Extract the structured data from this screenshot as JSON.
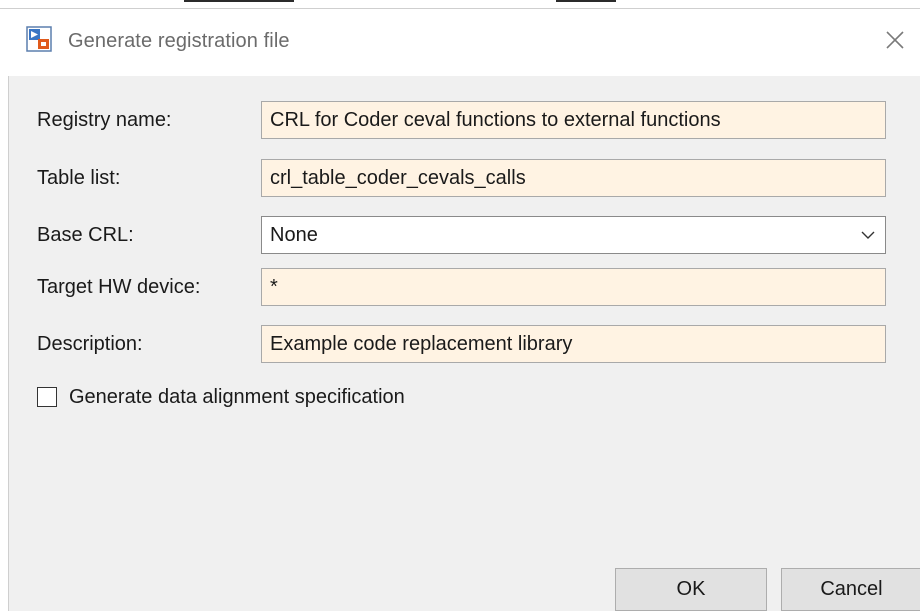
{
  "window": {
    "title": "Generate registration file",
    "icon": "simulink-app-icon",
    "close_icon": "close-icon"
  },
  "form": {
    "registry_name": {
      "label": "Registry name:",
      "value": "CRL for Coder ceval functions to external functions"
    },
    "table_list": {
      "label": "Table list:",
      "value": "crl_table_coder_cevals_calls"
    },
    "base_crl": {
      "label": "Base CRL:",
      "value": "None"
    },
    "target_hw_device": {
      "label": "Target HW device:",
      "value": "*"
    },
    "description": {
      "label": "Description:",
      "value": "Example code replacement library"
    },
    "data_alignment": {
      "label": "Generate data alignment specification",
      "checked": false
    }
  },
  "buttons": {
    "ok": "OK",
    "cancel": "Cancel"
  },
  "colors": {
    "field_background": "#fff3e3",
    "panel_background": "#f0f0f0",
    "button_background": "#e1e1e1"
  }
}
